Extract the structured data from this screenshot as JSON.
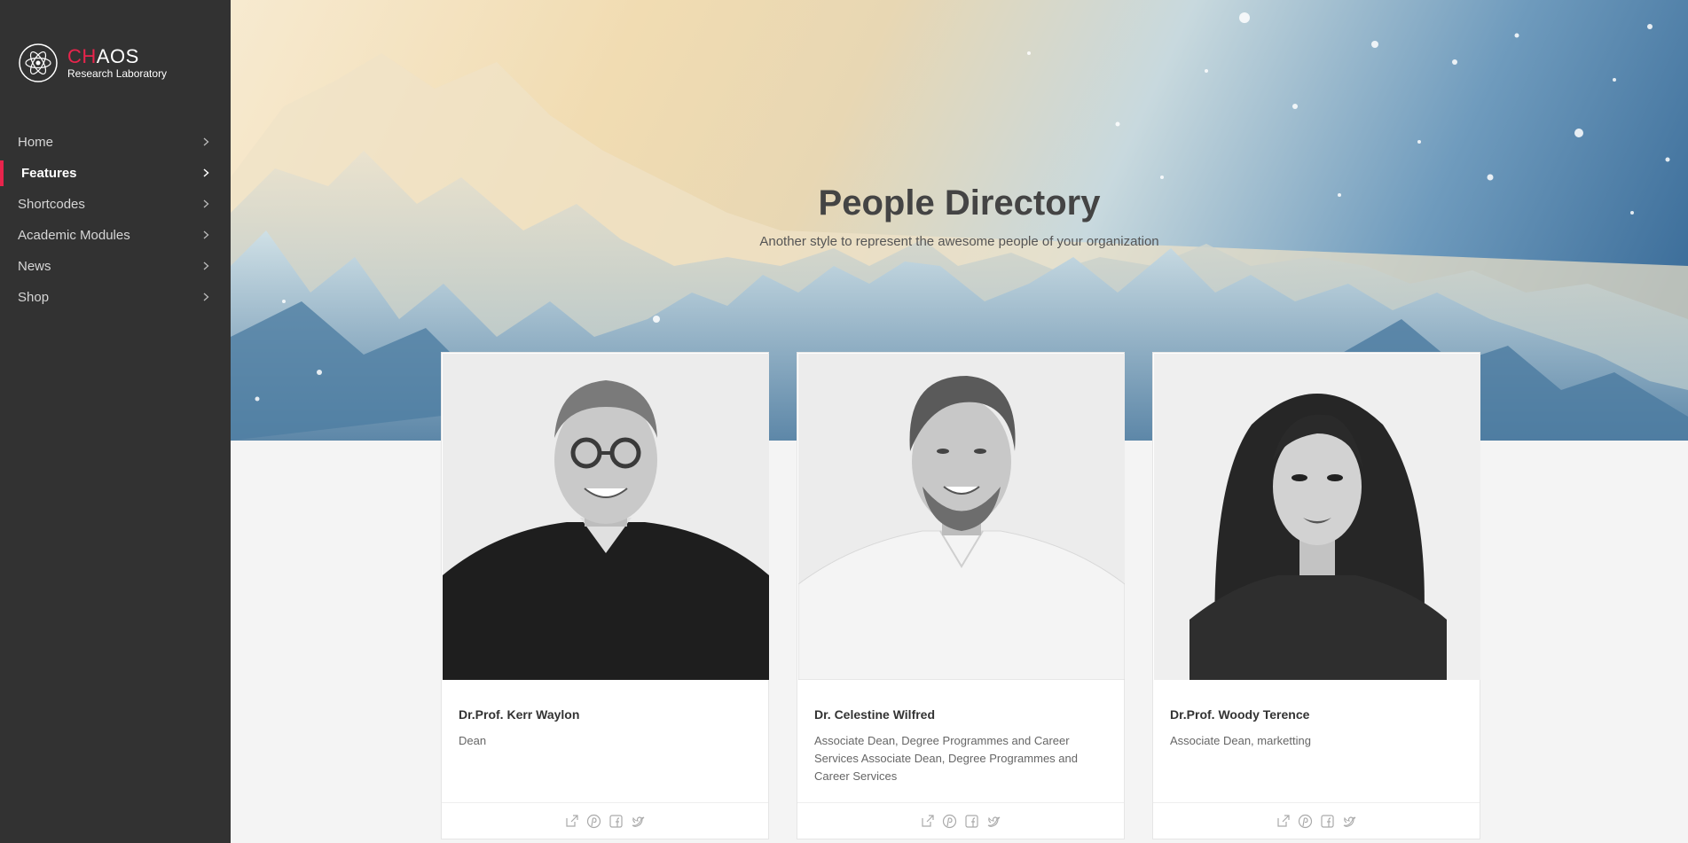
{
  "brand": {
    "name_accent": "CH",
    "name_rest": "AOS",
    "subtitle": "Research Laboratory"
  },
  "nav": [
    {
      "label": "Home",
      "active": false
    },
    {
      "label": "Features",
      "active": true
    },
    {
      "label": "Shortcodes",
      "active": false
    },
    {
      "label": "Academic Modules",
      "active": false
    },
    {
      "label": "News",
      "active": false
    },
    {
      "label": "Shop",
      "active": false
    }
  ],
  "hero": {
    "title": "People Directory",
    "subtitle": "Another style to represent the awesome people of your organization"
  },
  "people": [
    {
      "name": "Dr.Prof. Kerr Waylon",
      "role": "Dean"
    },
    {
      "name": "Dr. Celestine Wilfred",
      "role": "Associate Dean, Degree Programmes and Career Services Associate Dean, Degree Programmes and Career Services"
    },
    {
      "name": "Dr.Prof. Woody Terence",
      "role": "Associate Dean, marketting"
    }
  ],
  "social_icons": [
    "external-link-icon",
    "pinterest-icon",
    "facebook-icon",
    "twitter-icon"
  ],
  "colors": {
    "accent": "#e8244c",
    "sidebar": "#323232"
  }
}
